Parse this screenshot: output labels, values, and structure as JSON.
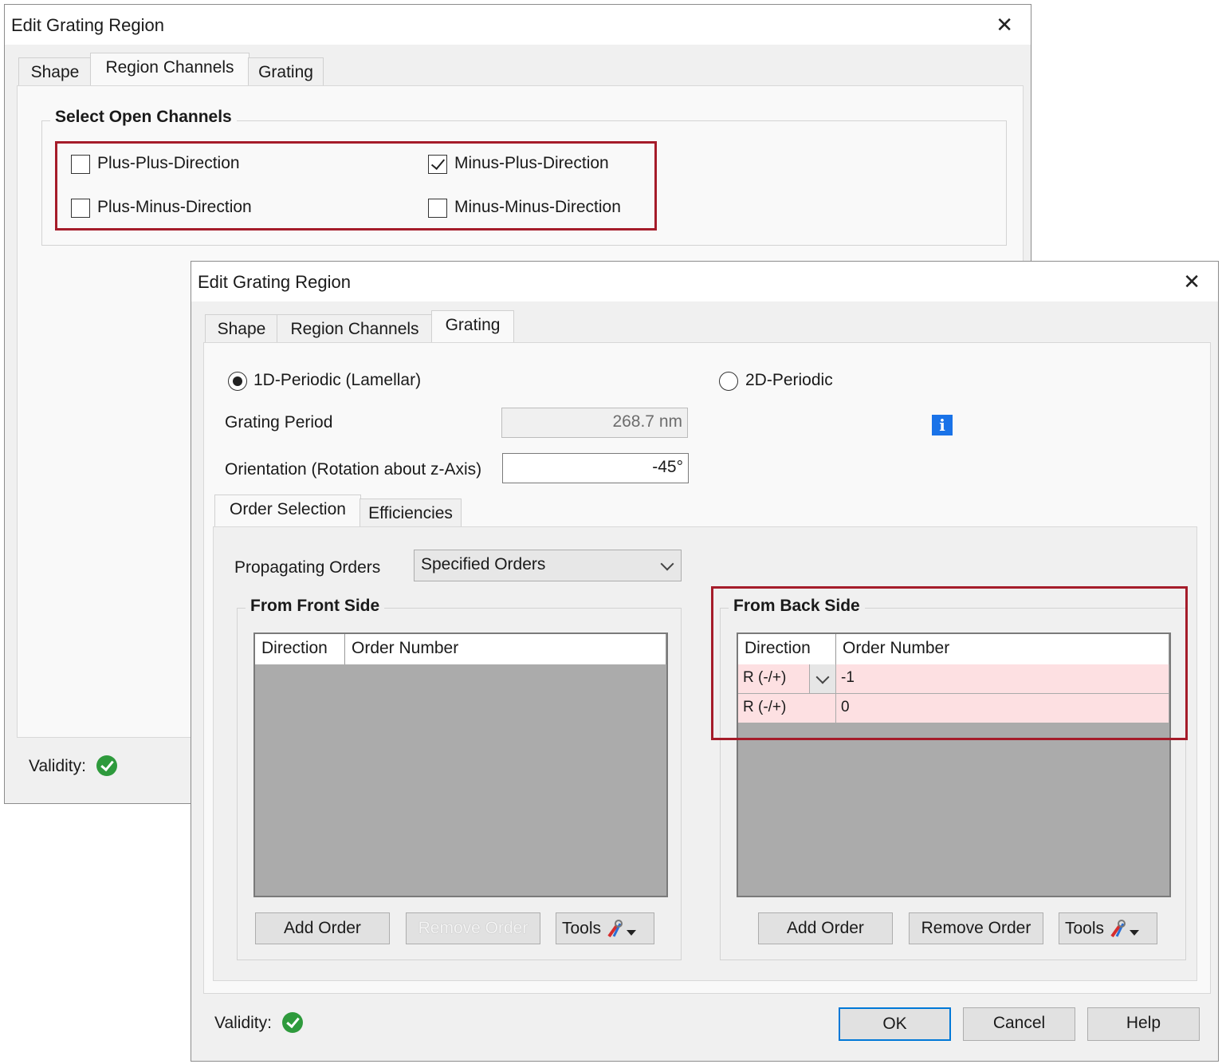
{
  "back_window": {
    "title": "Edit Grating Region",
    "tabs": [
      "Shape",
      "Region Channels",
      "Grating"
    ],
    "group_label": "Select Open Channels",
    "channels": [
      {
        "label": "Plus-Plus-Direction",
        "checked": false
      },
      {
        "label": "Minus-Plus-Direction",
        "checked": true
      },
      {
        "label": "Plus-Minus-Direction",
        "checked": false
      },
      {
        "label": "Minus-Minus-Direction",
        "checked": false
      }
    ],
    "validity_label": "Validity:"
  },
  "front_window": {
    "title": "Edit Grating Region",
    "tabs": [
      "Shape",
      "Region Channels",
      "Grating"
    ],
    "periodic_options": [
      "1D-Periodic (Lamellar)",
      "2D-Periodic"
    ],
    "selected_periodic": "1D-Periodic (Lamellar)",
    "grating_period_label": "Grating Period",
    "grating_period_value": "268.7 nm",
    "orientation_label": "Orientation (Rotation about z-Axis)",
    "orientation_value": "-45°",
    "info_glyph": "i",
    "subtabs": [
      "Order Selection",
      "Efficiencies"
    ],
    "propagating_orders_label": "Propagating Orders",
    "propagating_orders_value": "Specified Orders",
    "front_side": {
      "label": "From Front Side",
      "columns": [
        "Direction",
        "Order Number"
      ],
      "rows": []
    },
    "back_side": {
      "label": "From Back Side",
      "columns": [
        "Direction",
        "Order Number"
      ],
      "rows": [
        {
          "direction": "R (-/+)",
          "order": "-1"
        },
        {
          "direction": "R (-/+)",
          "order": "0"
        }
      ]
    },
    "buttons": {
      "add_order": "Add Order",
      "remove_order": "Remove Order",
      "tools": "Tools",
      "ok": "OK",
      "cancel": "Cancel",
      "help": "Help"
    },
    "validity_label": "Validity:"
  },
  "colors": {
    "highlight_border": "#a51c2a",
    "selected_row": "#fde0e2",
    "table_empty": "#ababab",
    "valid_green": "#2e9a3c",
    "info_blue": "#1a73e8"
  }
}
